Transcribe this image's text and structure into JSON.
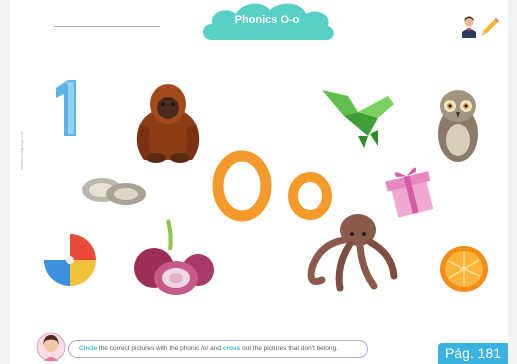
{
  "header": {
    "title": "Phonics O-o",
    "theme_color": "#56cfc4"
  },
  "side_text": "Kiddos Language Lab",
  "letters": {
    "upper": "O",
    "lower": "o",
    "color": "#f39a2b"
  },
  "instruction": {
    "circle_word": "Circle",
    "part1": " the correct pictures with the phonic /o/ and ",
    "cross_word": "cross",
    "part2": " out the pictures that don't belong."
  },
  "page_label": "Pág. 181",
  "pictures": [
    {
      "name": "number-one",
      "icon": "number-one-icon"
    },
    {
      "name": "orangutan",
      "icon": "orangutan-icon"
    },
    {
      "name": "origami",
      "icon": "origami-icon"
    },
    {
      "name": "owl",
      "icon": "owl-icon"
    },
    {
      "name": "oysters",
      "icon": "oysters-icon"
    },
    {
      "name": "gift",
      "icon": "gift-icon"
    },
    {
      "name": "ball",
      "icon": "ball-icon"
    },
    {
      "name": "onions",
      "icon": "onions-icon"
    },
    {
      "name": "octopus",
      "icon": "octopus-icon"
    },
    {
      "name": "orange",
      "icon": "orange-icon"
    }
  ]
}
